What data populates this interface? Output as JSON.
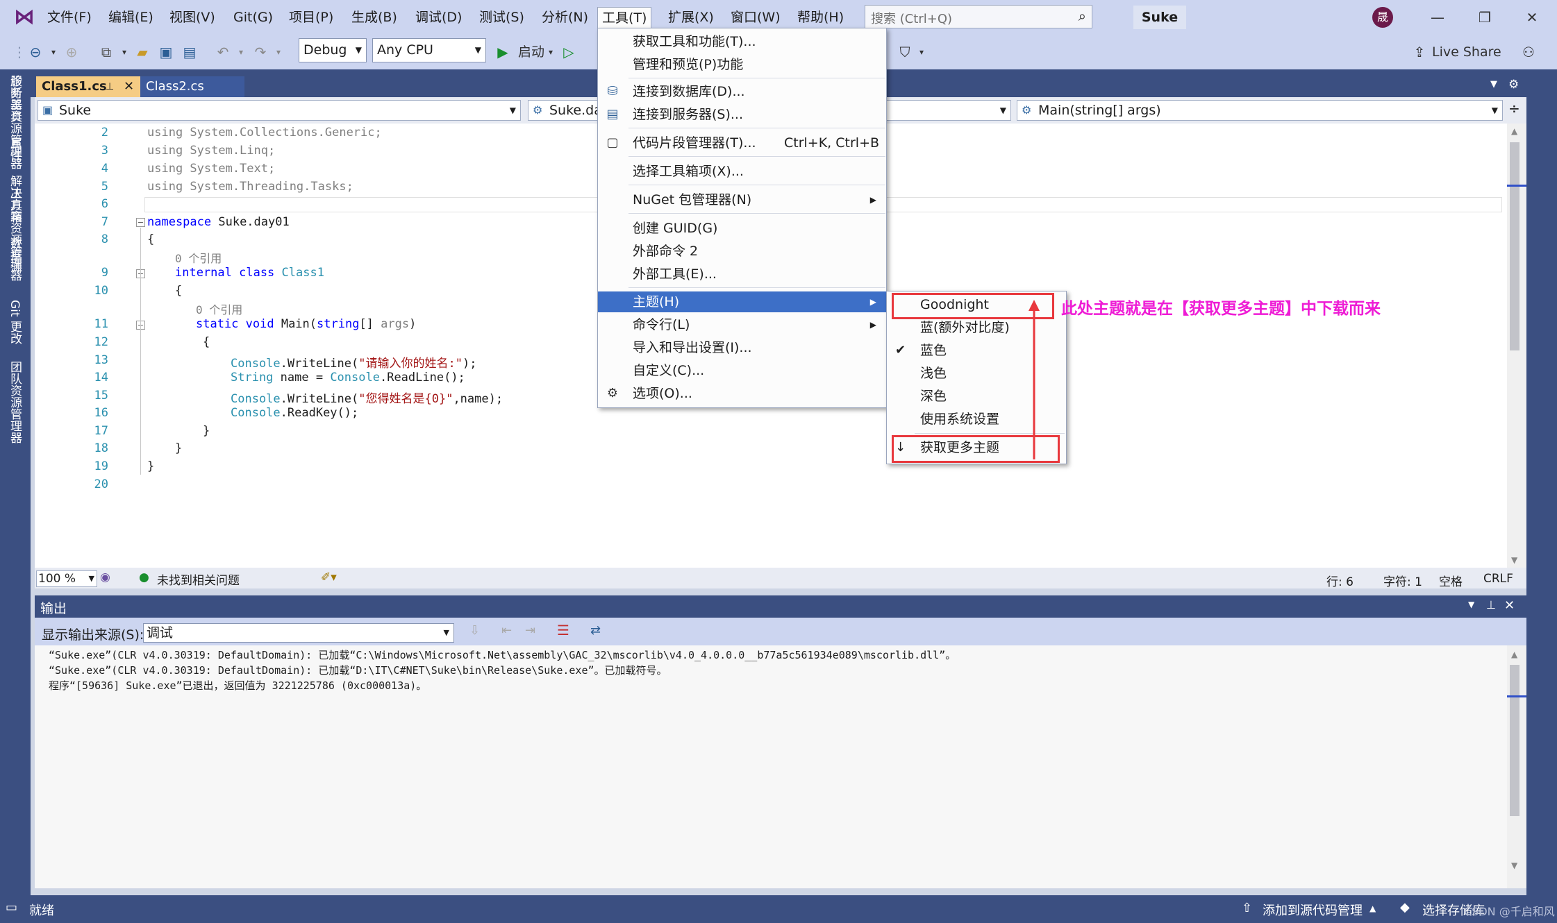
{
  "menubar": {
    "items": [
      "文件(F)",
      "编辑(E)",
      "视图(V)",
      "Git(G)",
      "项目(P)",
      "生成(B)",
      "调试(D)",
      "测试(S)",
      "分析(N)",
      "工具(T)",
      "扩展(X)",
      "窗口(W)",
      "帮助(H)"
    ],
    "search_placeholder": "搜索 (Ctrl+Q)",
    "solution_name": "Suke",
    "avatar_initial": "晟"
  },
  "toolbar": {
    "config": "Debug",
    "platform": "Any CPU",
    "start_label": "启动",
    "live_share": "Live Share"
  },
  "tabs": [
    "Class1.cs",
    "Class2.cs"
  ],
  "navbar": {
    "project": "Suke",
    "class": "Suke.day",
    "member": "Main(string[] args)"
  },
  "code": {
    "line_numbers": [
      "2",
      "3",
      "4",
      "5",
      "6",
      "7",
      "8",
      "9",
      "10",
      "11",
      "12",
      "13",
      "14",
      "15",
      "16",
      "17",
      "18",
      "19",
      "20"
    ],
    "using1": "using System.Collections.Generic;",
    "using2": "using System.Linq;",
    "using3": "using System.Text;",
    "using4": "using System.Threading.Tasks;",
    "ns_kw": "namespace",
    "ns_name": " Suke.day01",
    "brace_open": "{",
    "brace_close": "}",
    "refs": "0 个引用",
    "class_kw": "internal class",
    "class_name": " Class1",
    "main_kw": "static void",
    "main_name": " Main(",
    "main_type": "string",
    "main_params": "[] ",
    "main_arg": "args",
    "main_close": ")",
    "l13_a": "Console",
    "l13_b": ".WriteLine(",
    "l13_s": "\"请输入你的姓名:\"",
    "l13_c": ");",
    "l14_a": "String",
    "l14_b": " name = ",
    "l14_c": "Console",
    "l14_d": ".ReadLine();",
    "l15_a": "Console",
    "l15_b": ".WriteLine(",
    "l15_s": "\"您得姓名是{0}\"",
    "l15_c": ",name);",
    "l16_a": "Console",
    "l16_b": ".ReadKey();"
  },
  "editor_status": {
    "zoom": "100 %",
    "issues": "未找到相关问题",
    "line": "行: 6",
    "char": "字符: 1",
    "space": "空格",
    "eol": "CRLF"
  },
  "output": {
    "title": "输出",
    "source_label": "显示输出来源(S):",
    "source_value": "调试",
    "lines": [
      "“Suke.exe”(CLR v4.0.30319: DefaultDomain): 已加载“C:\\Windows\\Microsoft.Net\\assembly\\GAC_32\\mscorlib\\v4.0_4.0.0.0__b77a5c561934e089\\mscorlib.dll”。",
      "“Suke.exe”(CLR v4.0.30319: DefaultDomain): 已加载“D:\\IT\\C#NET\\Suke\\bin\\Release\\Suke.exe”。已加载符号。",
      "程序“[59636] Suke.exe”已退出，返回值为 3221225786 (0xc000013a)。"
    ]
  },
  "statusbar": {
    "ready": "就绪",
    "add_source": "添加到源代码管理",
    "select_repo": "选择存储库",
    "watermark": "CSDN @千启和风"
  },
  "left_rail": [
    "服务器资源管理器",
    "工具箱",
    "数据源"
  ],
  "right_rail": [
    "诊断工具",
    "属性",
    "解决方案资源管理器",
    "Git 更改",
    "团队资源管理器"
  ],
  "tools_menu": {
    "get_tools": "获取工具和功能(T)...",
    "manage_preview": "管理和预览(P)功能",
    "connect_db": "连接到数据库(D)...",
    "connect_server": "连接到服务器(S)...",
    "snippet_mgr": "代码片段管理器(T)...",
    "snippet_shortcut": "Ctrl+K, Ctrl+B",
    "choose_toolbox": "选择工具箱项(X)...",
    "nuget": "NuGet 包管理器(N)",
    "create_guid": "创建 GUID(G)",
    "ext_cmd2": "外部命令 2",
    "ext_tools": "外部工具(E)...",
    "theme": "主题(H)",
    "cmdline": "命令行(L)",
    "import_export": "导入和导出设置(I)...",
    "customize": "自定义(C)...",
    "options": "选项(O)..."
  },
  "theme_menu": {
    "items": [
      "Goodnight",
      "蓝(额外对比度)",
      "蓝色",
      "浅色",
      "深色",
      "使用系统设置",
      "获取更多主题"
    ],
    "checked": "蓝色"
  },
  "annotation": "此处主题就是在【获取更多主题】中下载而来"
}
